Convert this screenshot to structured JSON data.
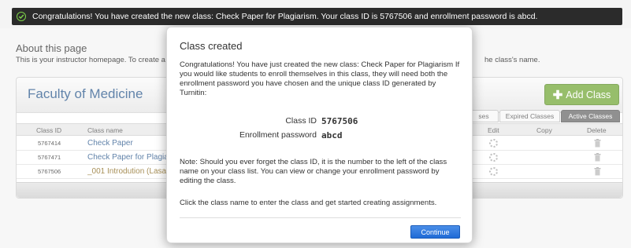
{
  "banner": {
    "message": "Congratulations! You have created the new class: Check Paper for Plagiarism. Your class ID is 5767506 and enrollment password is abcd."
  },
  "about": {
    "title": "About this page",
    "text_left": "This is your instructor homepage. To create a",
    "text_right": "he class's name."
  },
  "panel": {
    "department": "Faculty of Medicine",
    "add_button": "Add Class",
    "tabs": [
      "ses",
      "Expired Classes",
      "Active Classes"
    ],
    "columns": {
      "class_id": "Class ID",
      "class_name": "Class name",
      "edit": "Edit",
      "copy": "Copy",
      "delete": "Delete"
    },
    "rows": [
      {
        "id": "5767414",
        "name": "Check Paper"
      },
      {
        "id": "5767471",
        "name": "Check Paper for Plagia"
      },
      {
        "id": "5767506",
        "name": "_001 Introdution (Lasal"
      }
    ]
  },
  "modal": {
    "title": "Class created",
    "body": "Congratulations! You have just created the new class: Check Paper for Plagiarism If you would like students to enroll themselves in this class, they will need both the enrollment password you have chosen and the unique class ID generated by Turnitin:",
    "class_id_label": "Class ID",
    "class_id_value": "5767506",
    "password_label": "Enrollment password",
    "password_value": "abcd",
    "note": "Note: Should you ever forget the class ID, it is the number to the left of the class name on your class list. You can view or change your enrollment password by editing the class.",
    "hint": "Click the class name to enter the class and get started creating assignments.",
    "continue_label": "Continue"
  }
}
